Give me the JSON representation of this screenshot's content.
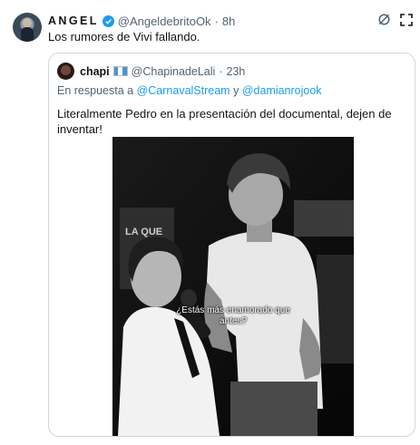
{
  "tweet": {
    "display_name": "ANGEL",
    "handle": "@AngeldebritoOk",
    "separator": "·",
    "time": "8h",
    "text": "Los rumores de Vivi fallando.",
    "icons": {
      "verified": "verified-badge-icon",
      "grok": "grok-icon",
      "expand": "expand-icon"
    },
    "colors": {
      "verified": "#1d9bf0",
      "muted": "#536471",
      "link": "#1d9bf0"
    }
  },
  "quote": {
    "display_name": "chapi",
    "flag": "guatemala-flag-icon",
    "handle": "@ChapinadeLali",
    "separator": "·",
    "time": "23h",
    "reply_prefix": "En respuesta a",
    "reply_mention_1": "@CarnavalStream",
    "reply_conjunction": "y",
    "reply_mention_2": "@damianrojook",
    "text": "Literalmente Pedro en la presentación del documental, dejen de inventar!",
    "video": {
      "background_sign": "LA QUE",
      "caption_line_1": "¿Estás más enamorado que",
      "caption_line_2": "antes?"
    }
  }
}
